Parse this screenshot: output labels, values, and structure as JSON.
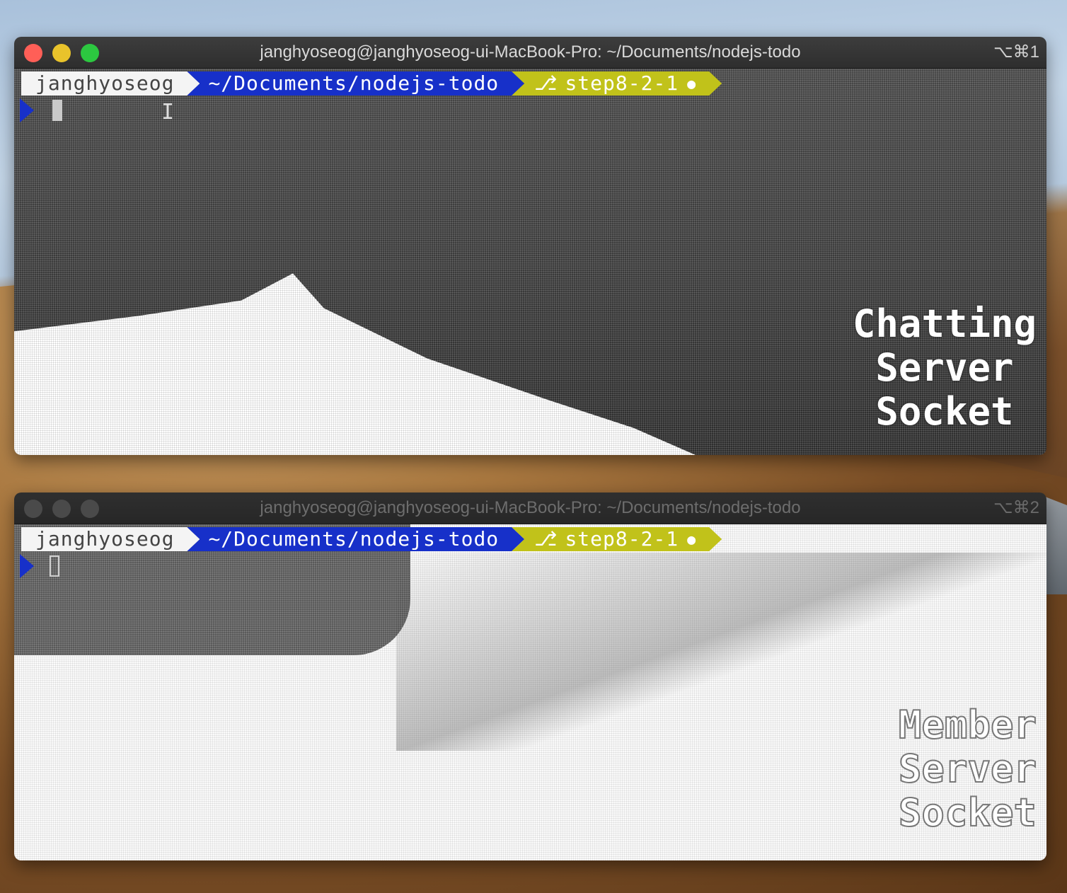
{
  "terminals": [
    {
      "active": true,
      "title": "janghyoseog@janghyoseog-ui-MacBook-Pro: ~/Documents/nodejs-todo",
      "shortcut": "⌥⌘1",
      "prompt": {
        "user": "janghyoseog",
        "dir": "~/Documents/nodejs-todo",
        "branch_icon": "⎇",
        "branch": "step8-2-1",
        "dirty_icon": "●"
      },
      "badge": [
        "Chatting",
        "Server",
        "Socket"
      ]
    },
    {
      "active": false,
      "title": "janghyoseog@janghyoseog-ui-MacBook-Pro: ~/Documents/nodejs-todo",
      "shortcut": "⌥⌘2",
      "prompt": {
        "user": "janghyoseog",
        "dir": "~/Documents/nodejs-todo",
        "branch_icon": "⎇",
        "branch": "step8-2-1",
        "dirty_icon": "●"
      },
      "badge": [
        "Member",
        "Server",
        "Socket"
      ]
    }
  ],
  "colors": {
    "prompt_user_bg": "#f4f4f4",
    "prompt_dir_bg": "#1730c9",
    "prompt_git_bg": "#c1c21a",
    "close": "#ff5f57",
    "minimize": "#e9c32b",
    "zoom": "#2cc840"
  },
  "icons": [
    "close-icon",
    "minimize-icon",
    "zoom-icon",
    "branch-icon",
    "dirty-icon",
    "prompt-caret-icon",
    "ibeam-cursor-icon"
  ]
}
